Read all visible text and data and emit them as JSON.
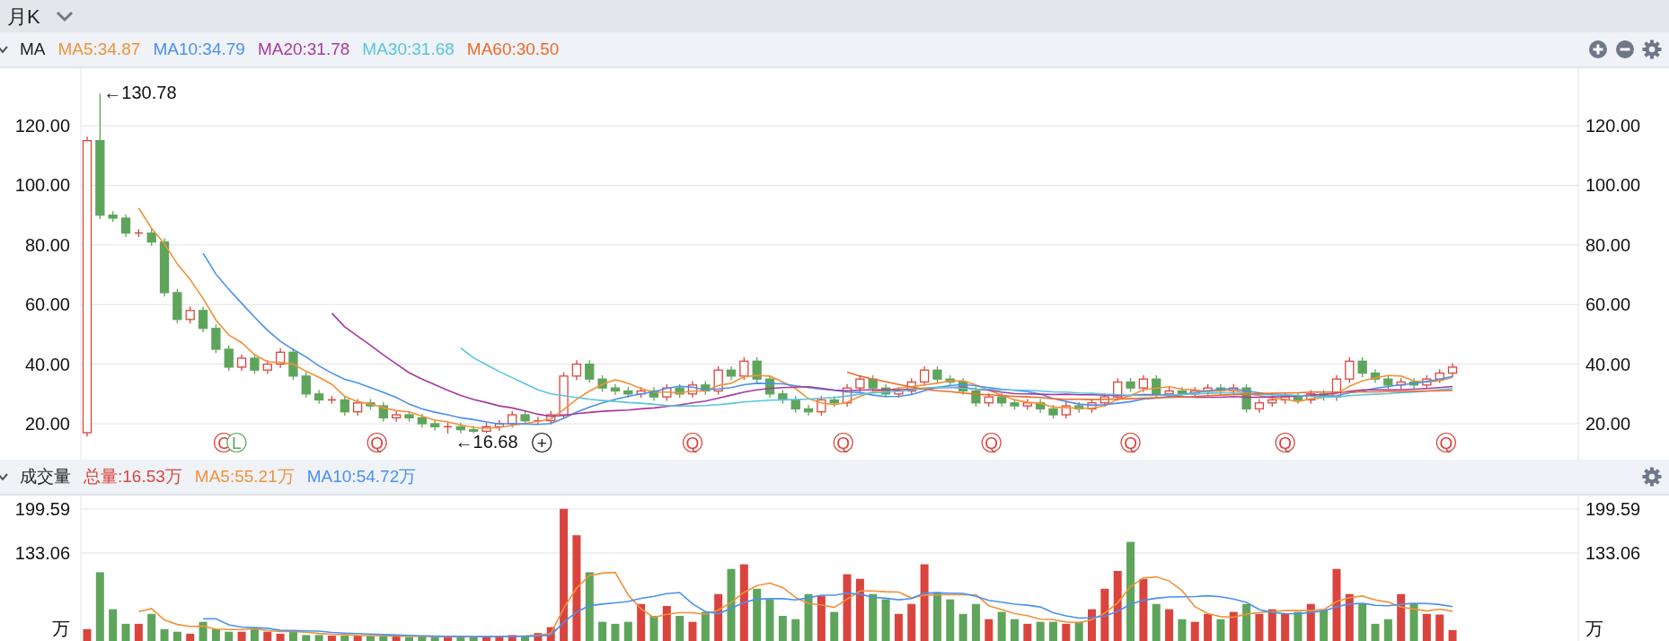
{
  "period_bar": {
    "label": "月K"
  },
  "price_panel": {
    "title": "MA",
    "legend": [
      {
        "label": "MA5:34.87",
        "color": "#f0923a"
      },
      {
        "label": "MA10:34.79",
        "color": "#4a90ef"
      },
      {
        "label": "MA20:31.78",
        "color": "#a8399e"
      },
      {
        "label": "MA30:31.68",
        "color": "#57c5dd"
      },
      {
        "label": "MA60:30.50",
        "color": "#ee6a2c"
      }
    ],
    "right_axis": {
      "labels": [
        "120.00",
        "100.00",
        "80.00",
        "60.00",
        "40.00",
        "20.00"
      ]
    },
    "extremes": [
      {
        "label": "←130.78"
      },
      {
        "label": "←16.68"
      }
    ],
    "events": [
      {
        "label": "C",
        "color": "#d9453e"
      },
      {
        "label": "L",
        "color": "#5ea55b"
      },
      {
        "label": "Q",
        "color": "#d9453e"
      },
      {
        "label": "+",
        "color": "#222222"
      },
      {
        "label": "Q",
        "color": "#d9453e"
      },
      {
        "label": "Q",
        "color": "#d9453e"
      },
      {
        "label": "Q",
        "color": "#d9453e"
      },
      {
        "label": "Q",
        "color": "#d9453e"
      },
      {
        "label": "Q",
        "color": "#d9453e"
      },
      {
        "label": "Q",
        "color": "#d9453e"
      }
    ],
    "chart_data": {
      "type": "candlestick",
      "grid": true,
      "ylim": [
        7.95,
        139.3
      ],
      "ohlc": [
        [
          17,
          116.3,
          15.7,
          115
        ],
        [
          115,
          130.78,
          88.7,
          90
        ],
        [
          90,
          91.3,
          87.7,
          89
        ],
        [
          89,
          90.3,
          82.7,
          84
        ],
        [
          84,
          85.3,
          82.7,
          84
        ],
        [
          84,
          85.3,
          79.7,
          81
        ],
        [
          81,
          82.3,
          62.7,
          64
        ],
        [
          64,
          65.3,
          53.7,
          55
        ],
        [
          55,
          59.3,
          53.7,
          58
        ],
        [
          58,
          59.3,
          50.7,
          52
        ],
        [
          52,
          53.3,
          43.7,
          45
        ],
        [
          45,
          46.3,
          37.7,
          39
        ],
        [
          39,
          43.3,
          37.7,
          42
        ],
        [
          42,
          43.3,
          36.7,
          38
        ],
        [
          38,
          41.3,
          36.7,
          40
        ],
        [
          40,
          45.3,
          38.7,
          44
        ],
        [
          44,
          45.3,
          34.7,
          36
        ],
        [
          36,
          37.3,
          28.7,
          30
        ],
        [
          30,
          31.3,
          26.7,
          28
        ],
        [
          28,
          29.3,
          26.7,
          28
        ],
        [
          28,
          29.3,
          22.7,
          24
        ],
        [
          24,
          28.3,
          22.7,
          27
        ],
        [
          27,
          28.3,
          24.7,
          26
        ],
        [
          26,
          27.3,
          20.7,
          22
        ],
        [
          22,
          24.3,
          20.7,
          23
        ],
        [
          23,
          24.3,
          20.7,
          22
        ],
        [
          22,
          23.3,
          18.7,
          20
        ],
        [
          20,
          21.3,
          17.7,
          19
        ],
        [
          19,
          20.3,
          16.68,
          19
        ],
        [
          19,
          20.3,
          16.8,
          18
        ],
        [
          18,
          19.3,
          16.8,
          17.5
        ],
        [
          17.5,
          20.3,
          16.8,
          19
        ],
        [
          19,
          21.3,
          17.7,
          20
        ],
        [
          20,
          24.3,
          18.7,
          23
        ],
        [
          23,
          24.3,
          19.7,
          21
        ],
        [
          21,
          22.3,
          19.7,
          21
        ],
        [
          21,
          24.3,
          19.7,
          23
        ],
        [
          23,
          37.3,
          21.7,
          36
        ],
        [
          36,
          41.3,
          34.7,
          40
        ],
        [
          40,
          41.3,
          33.7,
          35
        ],
        [
          35,
          36.3,
          30.7,
          32
        ],
        [
          32,
          33.3,
          29.7,
          31
        ],
        [
          31,
          32.3,
          28.7,
          30
        ],
        [
          30,
          32.3,
          28.7,
          31
        ],
        [
          31,
          32.3,
          27.7,
          29
        ],
        [
          29,
          33.3,
          27.7,
          32
        ],
        [
          32,
          33.3,
          28.7,
          30
        ],
        [
          30,
          34.3,
          28.7,
          33
        ],
        [
          33,
          34.3,
          29.7,
          31
        ],
        [
          31,
          39.3,
          29.7,
          38
        ],
        [
          38,
          39.3,
          34.7,
          36
        ],
        [
          36,
          42.3,
          34.7,
          41
        ],
        [
          41,
          42.3,
          33.7,
          35
        ],
        [
          35,
          36.3,
          28.7,
          30
        ],
        [
          30,
          31.3,
          26.7,
          28
        ],
        [
          28,
          29.3,
          23.7,
          25
        ],
        [
          25,
          26.3,
          22.7,
          24
        ],
        [
          24,
          29.3,
          22.7,
          28
        ],
        [
          28,
          29.3,
          25.7,
          27
        ],
        [
          27,
          33.3,
          25.7,
          32
        ],
        [
          32,
          36.3,
          30.7,
          35
        ],
        [
          35,
          36.3,
          30.7,
          32
        ],
        [
          32,
          33.3,
          28.7,
          30
        ],
        [
          30,
          32.3,
          28.7,
          31
        ],
        [
          31,
          35.3,
          29.7,
          34
        ],
        [
          34,
          39.3,
          32.7,
          38
        ],
        [
          38,
          39.3,
          33.7,
          35
        ],
        [
          35,
          36.3,
          32.7,
          34
        ],
        [
          34,
          35.3,
          29.7,
          31
        ],
        [
          31,
          32.3,
          25.7,
          27
        ],
        [
          27,
          30.3,
          25.7,
          29
        ],
        [
          29,
          30.3,
          25.7,
          27
        ],
        [
          27,
          28.3,
          24.7,
          26
        ],
        [
          26,
          28.3,
          24.7,
          27
        ],
        [
          27,
          28.3,
          23.7,
          25
        ],
        [
          25,
          26.3,
          21.7,
          23
        ],
        [
          23,
          27.3,
          21.7,
          26
        ],
        [
          26,
          27.3,
          23.7,
          25
        ],
        [
          25,
          28.3,
          23.7,
          27
        ],
        [
          27,
          30.3,
          25.7,
          29
        ],
        [
          29,
          35.3,
          27.7,
          34
        ],
        [
          34,
          35.3,
          30.7,
          32
        ],
        [
          32,
          36.3,
          30.7,
          35
        ],
        [
          35,
          36.3,
          28.7,
          30
        ],
        [
          30,
          32.3,
          28.7,
          31
        ],
        [
          31,
          32.3,
          28.7,
          30
        ],
        [
          30,
          32.3,
          28.7,
          31
        ],
        [
          31,
          33.3,
          29.7,
          32
        ],
        [
          32,
          33.3,
          29.7,
          31
        ],
        [
          31,
          33.3,
          29.7,
          32
        ],
        [
          32,
          33.3,
          23.7,
          25
        ],
        [
          25,
          28.3,
          23.7,
          27
        ],
        [
          27,
          29.3,
          25.7,
          28
        ],
        [
          28,
          30.3,
          26.7,
          29
        ],
        [
          29,
          30.3,
          26.7,
          28
        ],
        [
          28,
          31.3,
          26.7,
          30
        ],
        [
          30,
          31.3,
          27.7,
          29
        ],
        [
          29,
          36.3,
          27.7,
          35
        ],
        [
          35,
          42.3,
          33.7,
          41
        ],
        [
          41,
          42.3,
          35.7,
          37
        ],
        [
          37,
          38.3,
          33.7,
          35
        ],
        [
          35,
          36.3,
          31.7,
          33
        ],
        [
          33,
          35.3,
          31.7,
          34
        ],
        [
          34,
          35.3,
          31.7,
          33
        ],
        [
          33,
          36.3,
          31.7,
          35
        ],
        [
          35,
          38.3,
          33.7,
          37
        ],
        [
          37,
          40.3,
          35.7,
          39
        ]
      ],
      "yticks": [
        {
          "value": 120,
          "label": "120.00"
        },
        {
          "value": 100,
          "label": "100.00"
        },
        {
          "value": 80,
          "label": "80.00"
        },
        {
          "value": 60,
          "label": "60.00"
        },
        {
          "value": 40,
          "label": "40.00"
        },
        {
          "value": 20,
          "label": "20.00"
        }
      ],
      "series": [
        {
          "type": "line",
          "color": "#f0923a",
          "values": [
            null,
            null,
            null,
            null,
            92.4,
            85.6,
            80.4,
            73.6,
            68.4,
            62.0,
            54.8,
            49.8,
            47.2,
            43.2,
            40.8,
            40.6,
            40.0,
            37.6,
            35.6,
            33.2,
            29.2,
            27.4,
            26.6,
            25.4,
            24.4,
            24.0,
            22.6,
            21.2,
            20.6,
            19.6,
            18.7,
            18.5,
            18.7,
            19.5,
            20.1,
            20.8,
            21.6,
            24.8,
            28.2,
            31.0,
            33.2,
            34.8,
            33.6,
            31.8,
            30.6,
            30.6,
            30.4,
            31.0,
            31.0,
            32.8,
            33.6,
            35.8,
            36.2,
            36.0,
            34.0,
            31.8,
            28.4,
            27.0,
            26.4,
            27.2,
            29.2,
            30.8,
            31.2,
            32.0,
            32.4,
            33.0,
            33.6,
            34.4,
            34.4,
            33.0,
            31.2,
            29.6,
            28.0,
            27.2,
            26.8,
            25.6,
            25.4,
            25.2,
            25.2,
            26.0,
            28.2,
            29.4,
            31.4,
            32.0,
            32.4,
            31.6,
            31.4,
            30.8,
            31.0,
            31.2,
            30.2,
            29.4,
            28.6,
            28.2,
            27.4,
            28.4,
            28.8,
            30.2,
            32.6,
            34.4,
            35.4,
            36.2,
            36.0,
            34.4,
            34.0,
            34.4,
            35.6
          ]
        },
        {
          "type": "line",
          "color": "#4a90ef",
          "values": [
            null,
            null,
            null,
            null,
            null,
            null,
            null,
            null,
            null,
            77.2,
            70.2,
            65.1,
            60.4,
            55.8,
            51.4,
            47.7,
            44.9,
            42.4,
            39.4,
            37.0,
            34.9,
            33.7,
            32.1,
            30.5,
            28.8,
            26.6,
            25.0,
            23.9,
            23.0,
            22.0,
            21.4,
            20.6,
            19.9,
            20.1,
            19.9,
            19.8,
            20.1,
            21.8,
            23.9,
            25.6,
            27.0,
            28.2,
            29.2,
            30.0,
            30.8,
            31.9,
            32.6,
            32.3,
            31.4,
            31.7,
            32.1,
            33.1,
            33.6,
            33.5,
            33.4,
            32.7,
            32.1,
            31.6,
            31.2,
            30.6,
            30.5,
            29.6,
            29.1,
            29.2,
            29.8,
            31.1,
            32.2,
            32.8,
            33.2,
            32.7,
            32.1,
            31.6,
            31.2,
            30.8,
            29.9,
            28.4,
            27.5,
            26.6,
            26.2,
            26.4,
            26.9,
            27.4,
            28.3,
            28.6,
            29.2,
            29.9,
            30.4,
            31.1,
            31.5,
            31.8,
            30.9,
            30.4,
            29.7,
            29.6,
            29.3,
            29.3,
            29.1,
            29.4,
            30.4,
            30.9,
            31.9,
            32.5,
            33.1,
            33.5,
            34.2,
            34.9,
            35.9
          ]
        },
        {
          "type": "line",
          "color": "#a8399e",
          "values": [
            null,
            null,
            null,
            null,
            null,
            null,
            null,
            null,
            null,
            null,
            null,
            null,
            null,
            null,
            null,
            null,
            null,
            null,
            null,
            57.1,
            52.5,
            49.4,
            46.3,
            43.1,
            40.1,
            37.1,
            35.0,
            33.1,
            31.2,
            29.5,
            28.1,
            27.1,
            26.0,
            25.3,
            24.3,
            23.2,
            22.5,
            22.8,
            23.4,
            23.8,
            24.2,
            24.4,
            24.6,
            25.0,
            25.3,
            25.8,
            26.3,
            27.0,
            27.6,
            28.6,
            29.6,
            30.6,
            31.4,
            31.8,
            32.1,
            32.3,
            32.4,
            31.9,
            31.3,
            31.1,
            31.3,
            31.4,
            31.4,
            31.4,
            31.6,
            31.9,
            32.1,
            32.2,
            32.2,
            31.6,
            31.3,
            30.6,
            30.1,
            30.0,
            29.9,
            29.8,
            29.9,
            29.7,
            29.7,
            29.6,
            29.5,
            29.5,
            29.8,
            29.7,
            29.6,
            29.1,
            28.9,
            28.9,
            28.9,
            29.1,
            28.9,
            28.9,
            29.0,
            29.1,
            29.3,
            29.6,
            29.8,
            30.3,
            30.9,
            31.4,
            31.4,
            31.4,
            31.4,
            31.6,
            31.8,
            32.1,
            32.5
          ]
        },
        {
          "type": "line",
          "color": "#57c5dd",
          "values": [
            null,
            null,
            null,
            null,
            null,
            null,
            null,
            null,
            null,
            null,
            null,
            null,
            null,
            null,
            null,
            null,
            null,
            null,
            null,
            null,
            null,
            null,
            null,
            null,
            null,
            null,
            null,
            null,
            null,
            45.4,
            42.1,
            39.8,
            37.5,
            35.5,
            33.4,
            31.4,
            30.0,
            29.4,
            28.8,
            28.2,
            27.8,
            27.5,
            27.1,
            26.9,
            26.5,
            26.1,
            25.9,
            26.0,
            26.1,
            26.4,
            26.8,
            27.3,
            27.6,
            27.9,
            28.0,
            28.1,
            28.3,
            28.6,
            28.8,
            29.3,
            29.9,
            30.3,
            30.6,
            30.9,
            31.3,
            31.9,
            32.3,
            32.2,
            31.9,
            31.7,
            31.6,
            31.4,
            31.3,
            31.2,
            31.0,
            30.7,
            30.6,
            30.3,
            30.2,
            29.9,
            29.8,
            29.5,
            29.5,
            29.5,
            29.6,
            29.8,
            30.0,
            30.2,
            30.3,
            30.3,
            30.0,
            29.8,
            29.7,
            29.7,
            29.5,
            29.2,
            29.0,
            29.0,
            29.4,
            29.7,
            29.9,
            30.1,
            30.4,
            30.6,
            30.9,
            31.4,
            31.8
          ]
        },
        {
          "type": "line",
          "color": "#ee6a2c",
          "values": [
            null,
            null,
            null,
            null,
            null,
            null,
            null,
            null,
            null,
            null,
            null,
            null,
            null,
            null,
            null,
            null,
            null,
            null,
            null,
            null,
            null,
            null,
            null,
            null,
            null,
            null,
            null,
            null,
            null,
            null,
            null,
            null,
            null,
            null,
            null,
            null,
            null,
            null,
            null,
            null,
            null,
            null,
            null,
            null,
            null,
            null,
            null,
            null,
            null,
            null,
            null,
            null,
            null,
            null,
            null,
            null,
            null,
            null,
            null,
            37.3,
            36.0,
            35.0,
            34.1,
            33.2,
            32.3,
            31.6,
            31.1,
            30.8,
            30.3,
            29.9,
            29.7,
            29.5,
            29.2,
            29.0,
            28.8,
            28.4,
            28.2,
            28.2,
            28.1,
            28.2,
            28.3,
            28.4,
            28.6,
            28.7,
            28.8,
            29.0,
            29.1,
            29.4,
            29.6,
            29.8,
            29.9,
            30.1,
            30.2,
            30.3,
            30.4,
            30.6,
            30.6,
            30.6,
            30.6,
            30.7,
            30.7,
            30.8,
            30.8,
            30.9,
            31.0,
            31.1,
            31.2
          ]
        }
      ]
    }
  },
  "volume_panel": {
    "title": "成交量",
    "legend": [
      {
        "label": "总量:16.53万",
        "color": "#d9453e"
      },
      {
        "label": "MA5:55.21万",
        "color": "#f0923a"
      },
      {
        "label": "MA10:54.72万",
        "color": "#4a90ef"
      }
    ],
    "unit": "万",
    "right_axis": {
      "labels": [
        "199.59",
        "133.06"
      ],
      "unit": "万"
    },
    "chart_data": {
      "type": "bar",
      "grid": true,
      "ylim": [
        0,
        220
      ],
      "yticks": [
        {
          "value": 199.59,
          "label": "199.59"
        },
        {
          "value": 133.06,
          "label": "133.06"
        }
      ],
      "values": [
        18,
        104,
        48,
        26,
        26,
        41,
        18,
        14,
        11,
        29,
        18,
        14,
        14,
        18,
        14,
        11,
        14,
        9,
        9,
        8,
        8,
        8,
        7,
        8,
        7,
        6,
        7,
        6,
        6,
        7,
        6,
        7,
        8,
        9,
        8,
        12,
        21,
        200,
        160,
        104,
        29,
        26,
        29,
        56,
        38,
        53,
        38,
        29,
        44,
        71,
        109,
        116,
        79,
        63,
        38,
        33,
        71,
        68,
        44,
        101,
        94,
        71,
        63,
        41,
        56,
        116,
        74,
        63,
        41,
        56,
        33,
        44,
        33,
        26,
        29,
        29,
        26,
        29,
        48,
        79,
        106,
        150,
        94,
        56,
        48,
        33,
        29,
        41,
        33,
        44,
        56,
        41,
        48,
        41,
        44,
        56,
        48,
        109,
        71,
        56,
        26,
        33,
        71,
        56,
        41,
        40,
        16.5
      ],
      "colors": [
        "#d9453e",
        "#5ea55b",
        "#5ea55b",
        "#5ea55b",
        "#d9453e",
        "#5ea55b",
        "#5ea55b",
        "#5ea55b",
        "#d9453e",
        "#5ea55b",
        "#5ea55b",
        "#5ea55b",
        "#d9453e",
        "#5ea55b",
        "#d9453e",
        "#d9453e",
        "#5ea55b",
        "#5ea55b",
        "#5ea55b",
        "#d9453e",
        "#5ea55b",
        "#d9453e",
        "#5ea55b",
        "#5ea55b",
        "#d9453e",
        "#5ea55b",
        "#5ea55b",
        "#5ea55b",
        "#d9453e",
        "#5ea55b",
        "#5ea55b",
        "#d9453e",
        "#d9453e",
        "#d9453e",
        "#5ea55b",
        "#d9453e",
        "#d9453e",
        "#d9453e",
        "#d9453e",
        "#5ea55b",
        "#5ea55b",
        "#5ea55b",
        "#5ea55b",
        "#d9453e",
        "#5ea55b",
        "#d9453e",
        "#5ea55b",
        "#d9453e",
        "#5ea55b",
        "#d9453e",
        "#5ea55b",
        "#d9453e",
        "#5ea55b",
        "#5ea55b",
        "#5ea55b",
        "#5ea55b",
        "#5ea55b",
        "#d9453e",
        "#5ea55b",
        "#d9453e",
        "#d9453e",
        "#5ea55b",
        "#5ea55b",
        "#d9453e",
        "#d9453e",
        "#d9453e",
        "#5ea55b",
        "#5ea55b",
        "#5ea55b",
        "#5ea55b",
        "#d9453e",
        "#5ea55b",
        "#5ea55b",
        "#d9453e",
        "#5ea55b",
        "#5ea55b",
        "#d9453e",
        "#5ea55b",
        "#d9453e",
        "#d9453e",
        "#d9453e",
        "#5ea55b",
        "#d9453e",
        "#5ea55b",
        "#d9453e",
        "#5ea55b",
        "#d9453e",
        "#d9453e",
        "#5ea55b",
        "#d9453e",
        "#5ea55b",
        "#d9453e",
        "#d9453e",
        "#d9453e",
        "#5ea55b",
        "#d9453e",
        "#5ea55b",
        "#d9453e",
        "#d9453e",
        "#5ea55b",
        "#5ea55b",
        "#5ea55b",
        "#d9453e",
        "#5ea55b",
        "#d9453e",
        "#d9453e",
        "#d9453e"
      ],
      "series": [
        {
          "type": "line",
          "color": "#f0923a",
          "values": [
            null,
            null,
            null,
            null,
            44.4,
            49.0,
            31.8,
            25.0,
            22.0,
            22.6,
            18.0,
            17.2,
            17.2,
            18.6,
            15.6,
            14.2,
            14.2,
            13.2,
            11.4,
            10.2,
            9.6,
            8.4,
            8.0,
            7.8,
            7.6,
            7.2,
            7.0,
            6.8,
            6.4,
            6.4,
            6.4,
            6.4,
            6.8,
            7.4,
            7.6,
            8.8,
            11.6,
            49.9,
            80.1,
            99.3,
            102.7,
            103.7,
            69.6,
            48.8,
            35.6,
            40.4,
            42.8,
            42.8,
            40.4,
            47.0,
            58.2,
            73.8,
            83.8,
            87.6,
            81.0,
            65.8,
            56.8,
            54.6,
            50.8,
            63.4,
            75.6,
            75.6,
            74.6,
            74.0,
            65.0,
            69.4,
            70.0,
            70.0,
            70.0,
            70.0,
            53.4,
            47.4,
            41.4,
            38.4,
            33.0,
            32.2,
            28.6,
            27.8,
            32.2,
            42.2,
            57.6,
            82.4,
            95.4,
            97.0,
            90.8,
            76.2,
            52.0,
            41.4,
            36.8,
            36.0,
            40.6,
            43.0,
            44.4,
            46.0,
            46.0,
            46.0,
            47.4,
            59.6,
            65.6,
            68.0,
            62.0,
            59.0,
            51.4,
            48.4,
            45.4,
            48.2,
            44.9
          ]
        },
        {
          "type": "line",
          "color": "#4a90ef",
          "values": [
            null,
            null,
            null,
            null,
            null,
            null,
            null,
            null,
            null,
            33.5,
            33.5,
            24.5,
            21.1,
            20.3,
            19.1,
            16.1,
            15.7,
            15.2,
            15.0,
            12.9,
            11.9,
            11.3,
            10.6,
            9.6,
            8.9,
            8.4,
            7.7,
            7.4,
            7.1,
            7.0,
            6.8,
            6.7,
            6.8,
            6.9,
            7.0,
            7.6,
            9.0,
            28.4,
            43.8,
            53.5,
            55.8,
            57.7,
            59.8,
            64.5,
            67.5,
            71.6,
            73.3,
            56.2,
            44.6,
            41.3,
            49.3,
            58.3,
            63.3,
            64.0,
            64.0,
            62.0,
            65.3,
            69.2,
            69.2,
            72.2,
            70.7,
            66.2,
            64.6,
            62.4,
            64.2,
            72.5,
            72.8,
            72.3,
            72.0,
            67.5,
            61.4,
            58.7,
            55.7,
            54.2,
            51.5,
            42.8,
            38.0,
            34.6,
            35.3,
            37.6,
            44.9,
            55.5,
            61.6,
            64.6,
            66.5,
            66.9,
            67.2,
            68.4,
            66.9,
            63.4,
            58.4,
            47.5,
            42.9,
            41.4,
            41.0,
            43.3,
            45.2,
            52.0,
            55.8,
            57.0,
            54.0,
            53.2,
            55.5,
            57.0,
            56.7,
            55.1,
            52.0
          ]
        }
      ]
    }
  }
}
